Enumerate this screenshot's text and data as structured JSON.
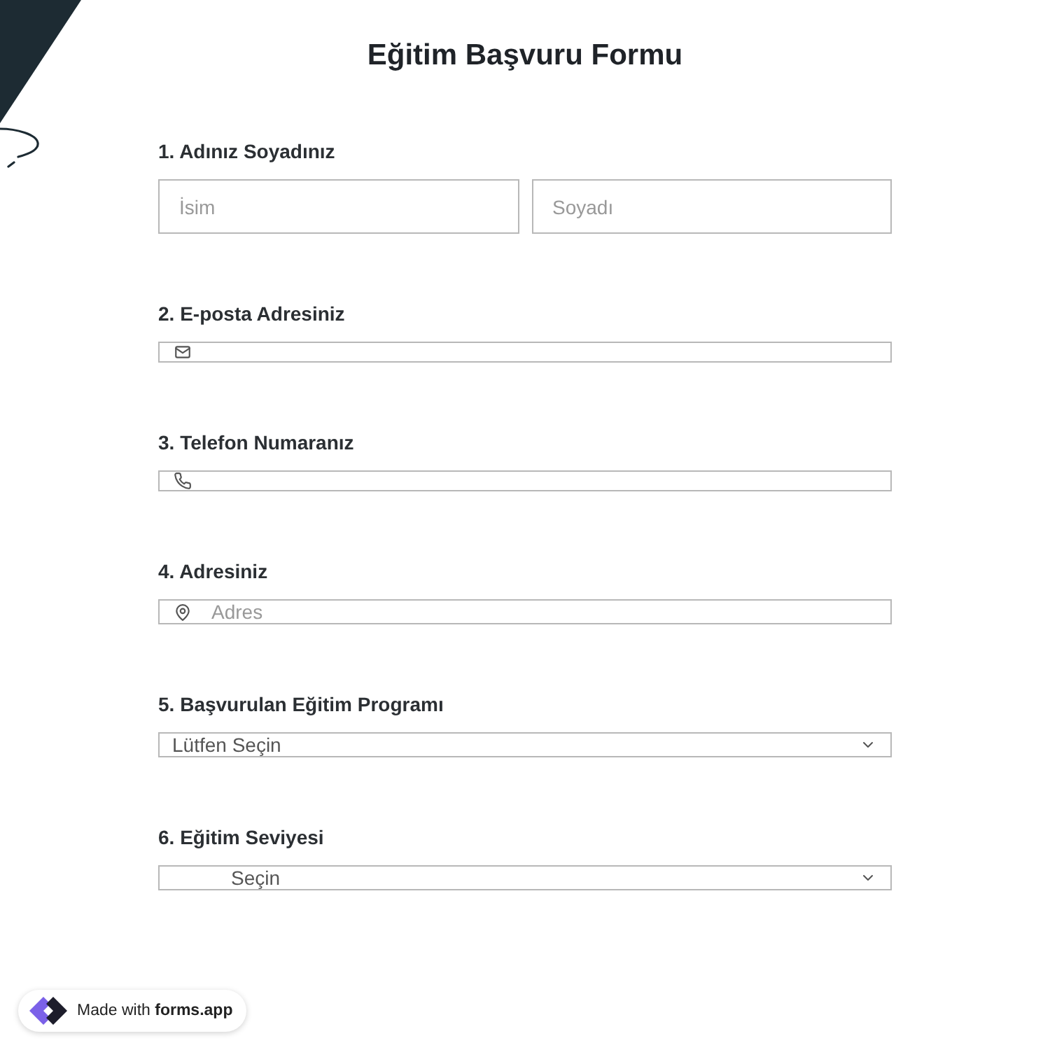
{
  "form": {
    "title": "Eğitim Başvuru Formu"
  },
  "questions": [
    {
      "number": "1.",
      "label": "Adınız Soyadınız",
      "kind": "name",
      "fields": [
        {
          "placeholder": "İsim"
        },
        {
          "placeholder": "Soyadı"
        }
      ]
    },
    {
      "number": "2.",
      "label": "E-posta Adresiniz",
      "kind": "email"
    },
    {
      "number": "3.",
      "label": "Telefon Numaranız",
      "kind": "phone"
    },
    {
      "number": "4.",
      "label": "Adresiniz",
      "kind": "address",
      "placeholder": "Adres"
    },
    {
      "number": "5.",
      "label": "Başvurulan Eğitim Programı",
      "kind": "select",
      "value": "Lütfen Seçin"
    },
    {
      "number": "6.",
      "label": "Eğitim Seviyesi",
      "kind": "select",
      "value": "Seçin"
    }
  ],
  "badge": {
    "prefix": "Made with",
    "brand": "forms.app"
  }
}
